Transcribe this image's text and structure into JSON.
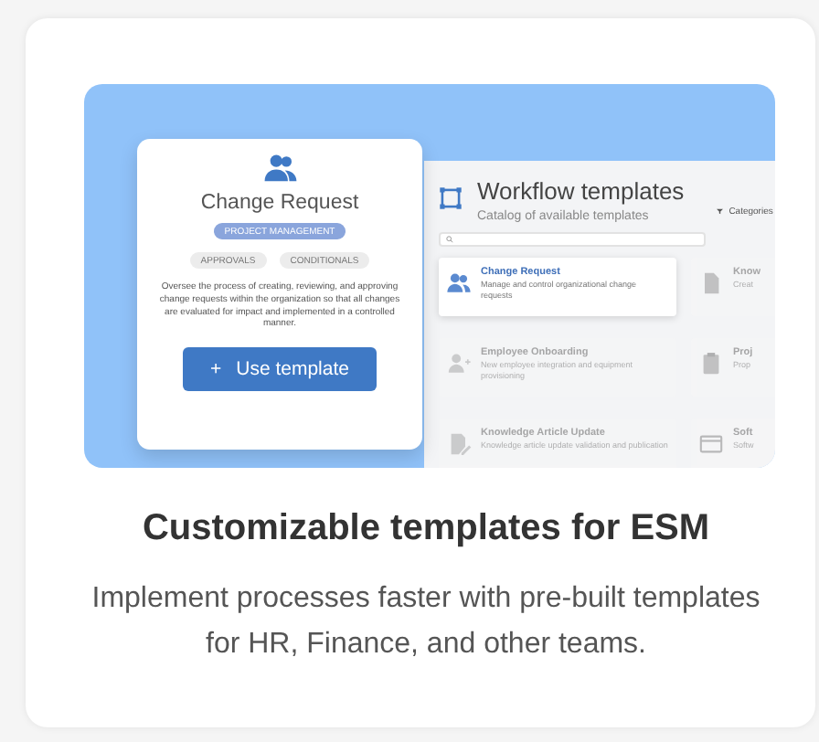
{
  "illustration": {
    "template_card": {
      "title": "Change Request",
      "primary_tag": "PROJECT MANAGEMENT",
      "tags": [
        "APPROVALS",
        "CONDITIONALS"
      ],
      "description": "Oversee the process of creating, reviewing, and approving change requests within the organization so that all changes are evaluated for impact and implemented in a controlled manner.",
      "button": {
        "icon": "+",
        "label": "Use template"
      }
    },
    "app": {
      "title": "Workflow templates",
      "subtitle": "Catalog of available templates",
      "filter": "Categories",
      "templates": [
        {
          "kind": "people",
          "title": "Change Request",
          "description": "Manage and control organizational change requests",
          "selected": true
        },
        {
          "kind": "doc",
          "title": "Know",
          "description": "Creat",
          "selected": false
        },
        {
          "kind": "person-add",
          "title": "Employee Onboarding",
          "description": "New employee integration and equipment provisioning",
          "selected": false
        },
        {
          "kind": "clipboard",
          "title": "Proj",
          "description": "Prop",
          "selected": false
        },
        {
          "kind": "edit",
          "title": "Knowledge Article Update",
          "description": "Knowledge article update validation and publication",
          "selected": false
        },
        {
          "kind": "window",
          "title": "Soft",
          "description": "Softw",
          "selected": false
        }
      ]
    }
  },
  "heading": "Customizable templates for ESM",
  "text": "Implement processes faster with pre-built templates for HR, Finance, and other teams."
}
